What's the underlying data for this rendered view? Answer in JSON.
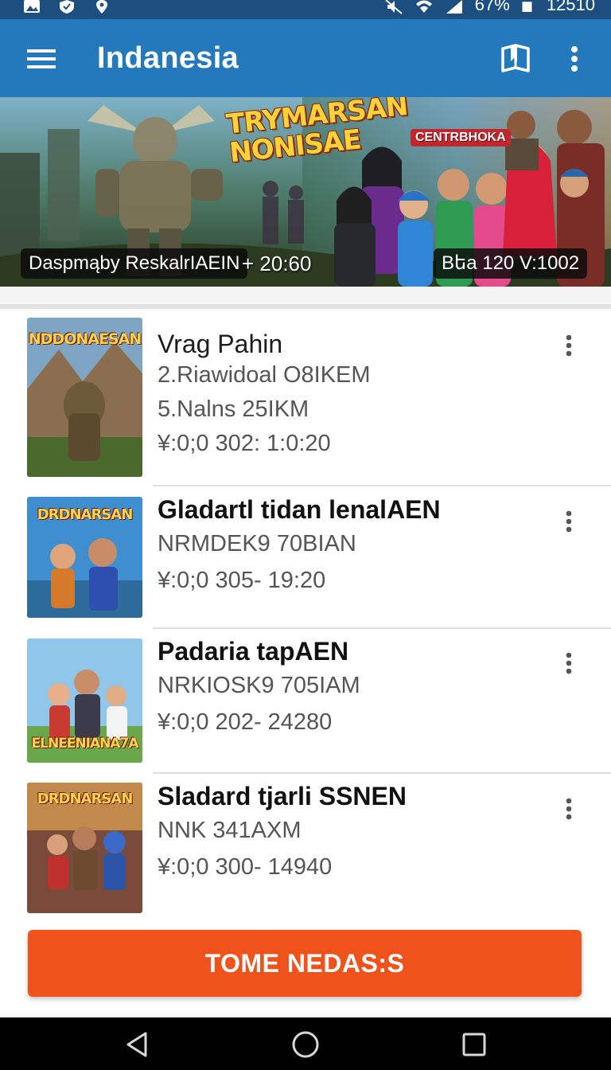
{
  "status_bar": {
    "battery": "67%",
    "time": "12510"
  },
  "app_bar": {
    "title": "Indanesia"
  },
  "banner": {
    "headline": "TRYMARSAN NONISAE",
    "sub_logo": "CENTRBHOKA",
    "left_caption": "Daspmąby ReskalrIAEIN",
    "left_time": "+ 20:60",
    "right_caption": "Bեa 120 V:1002"
  },
  "list": {
    "items": [
      {
        "thumb_label": "NDDONAESAN",
        "name": "Vrag Pahin",
        "lines": [
          "2.Riawidoal O8IKEM",
          "5.Nalns 25IKM",
          "¥:0;0 302: 1:0:20"
        ]
      },
      {
        "thumb_label": "DRDNARSAN",
        "name": "Gladartl tidan lenalAEN",
        "lines": [
          "NRMDEK9 70BIAN",
          "¥:0;0 305- 19:20"
        ]
      },
      {
        "thumb_label": "ELNEENIANA7A",
        "name": "Padaria tapAEN",
        "lines": [
          "NRKIOSK9 705IAM",
          "¥:0;0 202- 24280"
        ]
      },
      {
        "thumb_label": "DRDNARSAN",
        "name": "Sladard tjarli SSNEN",
        "lines": [
          "NNK 341AXM",
          "¥:0;0 300- 14940"
        ]
      }
    ]
  },
  "cta": {
    "label": "TOME NEDAS:S"
  },
  "colors": {
    "status_bar": "#1c4f80",
    "app_bar": "#2479bd",
    "cta": "#f0521c"
  }
}
